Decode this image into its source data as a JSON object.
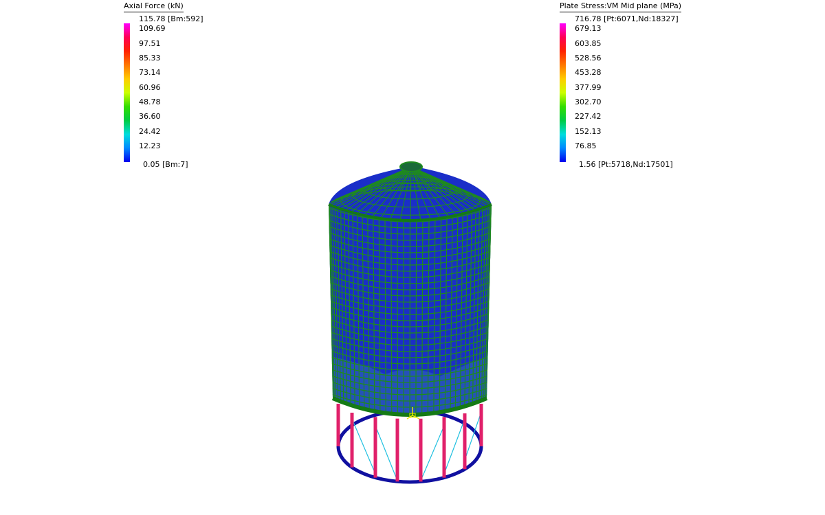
{
  "legend_left": {
    "title": "Axial Force  (kN)",
    "labels": [
      "115.78 [Bm:592]",
      "109.69",
      "97.51",
      "85.33",
      "73.14",
      "60.96",
      "48.78",
      "36.60",
      "24.42",
      "12.23",
      "0.05 [Bm:7]"
    ]
  },
  "legend_right": {
    "title": "Plate Stress:VM Mid plane  (MPa)",
    "labels": [
      "716.78 [Pt:6071,Nd:18327]",
      "679.13",
      "603.85",
      "528.56",
      "453.28",
      "377.99",
      "302.70",
      "227.42",
      "152.13",
      "76.85",
      "1.56 [Pt:5718,Nd:17501]"
    ]
  },
  "colors": {
    "scale": [
      "#ff00ff",
      "#ff0055",
      "#ff2200",
      "#ff7700",
      "#ffcc00",
      "#ccff00",
      "#33dd00",
      "#00cc44",
      "#00dddd",
      "#0088ff",
      "#0000ee"
    ],
    "mesh_fill": "#1a2ec8",
    "mesh_lines": "#1f8a1f",
    "rim": "#157a15",
    "columns": "#e0206a",
    "braces": "#20c0e0",
    "base_ring": "#1010a0",
    "origin_marker": "#e8e800"
  }
}
